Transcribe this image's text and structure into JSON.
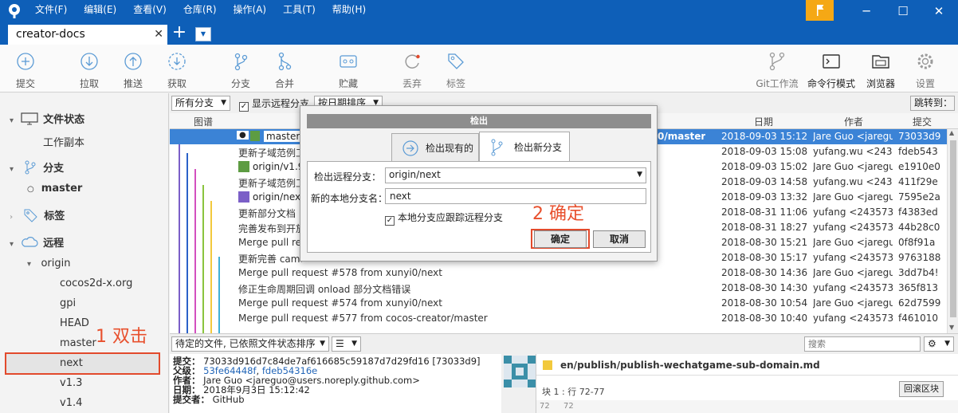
{
  "menu": [
    "文件(F)",
    "编辑(E)",
    "查看(V)",
    "仓库(R)",
    "操作(A)",
    "工具(T)",
    "帮助(H)"
  ],
  "tab": {
    "title": "creator-docs",
    "close": "✕",
    "add": "+"
  },
  "toolbar": {
    "left": [
      "提交",
      "拉取",
      "推送",
      "获取",
      "分支",
      "合并",
      "贮藏",
      "丢弃",
      "标签"
    ],
    "right": [
      "Git工作流",
      "命令行模式",
      "浏览器",
      "设置"
    ]
  },
  "sidebar": {
    "file_status": "文件状态",
    "working_copy": "工作副本",
    "branches": "分支",
    "master": "master",
    "tags": "标签",
    "remotes": "远程",
    "origin": "origin",
    "remote_items": [
      "cocos2d-x.org",
      "gpi",
      "HEAD",
      "master",
      "next",
      "v1.3",
      "v1.4"
    ]
  },
  "annotations": {
    "double_click": "1 双击",
    "confirm": "2 确定"
  },
  "filter": {
    "all_branches": "所有分支",
    "show_remote": "显示远程分支",
    "sort": "按日期排序",
    "jump": "跳转到："
  },
  "columns": {
    "graph": "图谱",
    "date": "日期",
    "author": "作者",
    "commit": "提交"
  },
  "commits": [
    {
      "msg": "master",
      "ref": "0/master",
      "date": "2018-09-03 15:12",
      "author": "Jare Guo <jaregu",
      "hash": "73033d9"
    },
    {
      "msg": "更新子域范例工",
      "ref": "",
      "date": "2018-09-03 15:08",
      "author": "yufang.wu <2435",
      "hash": "fdeb543"
    },
    {
      "msg": "origin/v1.9",
      "ref": "",
      "date": "2018-09-03 15:02",
      "author": "Jare Guo <jaregu",
      "hash": "e1910e0"
    },
    {
      "msg": "更新子域范例工",
      "ref": "",
      "date": "2018-09-03 14:58",
      "author": "yufang.wu <2435",
      "hash": "411f29e"
    },
    {
      "msg": "origin/next",
      "ref": "",
      "date": "2018-09-03 13:32",
      "author": "Jare Guo <jaregu",
      "hash": "7595e2a"
    },
    {
      "msg": "更新部分文档 .",
      "ref": "",
      "date": "2018-08-31 11:06",
      "author": "yufang <2435731",
      "hash": "f4383ed"
    },
    {
      "msg": "完善发布到开放",
      "ref": "",
      "date": "2018-08-31 18:27",
      "author": "yufang <2435731",
      "hash": "44b28c0"
    },
    {
      "msg": "Merge pull re",
      "ref": "",
      "date": "2018-08-30 15:21",
      "author": "Jare Guo <jaregu",
      "hash": "0f8f91a"
    },
    {
      "msg": "更新完善 came",
      "ref": "",
      "date": "2018-08-30 15:17",
      "author": "yufang <2435731",
      "hash": "9763188"
    },
    {
      "msg": "Merge pull request #578 from xunyi0/next",
      "ref": "",
      "date": "2018-08-30 14:36",
      "author": "Jare Guo <jaregu",
      "hash": "3dd7b4!"
    },
    {
      "msg": "修正生命周期回调 onload 部分文档错误",
      "ref": "",
      "date": "2018-08-30 14:30",
      "author": "yufang <2435731",
      "hash": "365f813"
    },
    {
      "msg": "Merge pull request #574 from xunyi0/next",
      "ref": "",
      "date": "2018-08-30 10:54",
      "author": "Jare Guo <jaregu",
      "hash": "62d7599"
    },
    {
      "msg": "Merge pull request #577 from cocos-creator/master",
      "ref": "",
      "date": "2018-08-30 10:40",
      "author": "yufang <2435731",
      "hash": "f461010"
    }
  ],
  "bottom": {
    "pending": "待定的文件, 已依照文件状态排序",
    "search_placeholder": "搜索"
  },
  "details": {
    "commit_label": "提交：",
    "commit": "73033d916d7c84de7af616685c59187d7d29fd16 [73033d9]",
    "parent_label": "父级：",
    "parent1": "53fe64448f",
    "parent2": "fdeb54316e",
    "author_label": "作者：",
    "author": "Jare Guo <jareguo@users.noreply.github.com>",
    "date_label": "日期：",
    "date": "2018年9月3日 15:12:42",
    "committer_label": "提交者：",
    "committer": "GitHub"
  },
  "diff": {
    "file": "en/publish/publish-wechatgame-sub-domain.md",
    "hunk": "块 1 : 行 72-77",
    "revert": "回滚区块",
    "ln1": "72",
    "ln2": "72"
  },
  "dialog": {
    "title": "检出",
    "tab_existing": "检出现有的",
    "tab_new": "检出新分支",
    "remote_label": "检出远程分支：",
    "remote_value": "origin/next",
    "local_label": "新的本地分支名：",
    "local_value": "next",
    "track_label": "本地分支应跟踪远程分支",
    "ok": "确定",
    "cancel": "取消"
  },
  "colors": {
    "accent": "#0e5fb8",
    "selection": "#3b83d6",
    "annotation": "#e24a2c"
  }
}
